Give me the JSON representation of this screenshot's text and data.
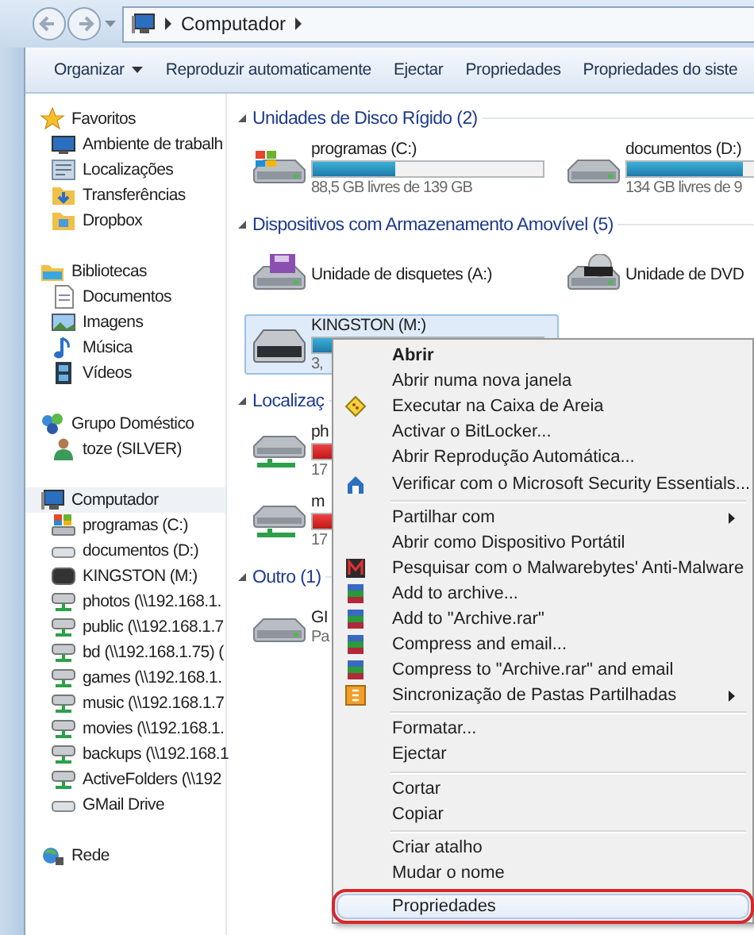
{
  "address_bar": {
    "path": [
      "Computador"
    ]
  },
  "toolbar": [
    {
      "label": "Organizar",
      "dropdown": true
    },
    {
      "label": "Reproduzir automaticamente",
      "dropdown": false
    },
    {
      "label": "Ejectar",
      "dropdown": false
    },
    {
      "label": "Propriedades",
      "dropdown": false
    },
    {
      "label": "Propriedades do siste",
      "dropdown": false
    }
  ],
  "sidebar": [
    {
      "label": "Favoritos",
      "kind": "star",
      "selected": false,
      "items": [
        {
          "label": "Ambiente de trabalh",
          "kind": "desktop"
        },
        {
          "label": "Localizações",
          "kind": "places"
        },
        {
          "label": "Transferências",
          "kind": "downloads"
        },
        {
          "label": "Dropbox",
          "kind": "folder"
        }
      ]
    },
    {
      "label": "Bibliotecas",
      "kind": "library",
      "selected": false,
      "items": [
        {
          "label": "Documentos",
          "kind": "document"
        },
        {
          "label": "Imagens",
          "kind": "picture"
        },
        {
          "label": "Música",
          "kind": "music"
        },
        {
          "label": "Vídeos",
          "kind": "film"
        }
      ]
    },
    {
      "label": "Grupo Doméstico",
      "kind": "homegroup",
      "selected": false,
      "items": [
        {
          "label": "toze (SILVER)",
          "kind": "user"
        }
      ]
    },
    {
      "label": "Computador",
      "kind": "computer",
      "selected": true,
      "items": [
        {
          "label": "programas (C:)",
          "kind": "windrive"
        },
        {
          "label": "documentos (D:)",
          "kind": "drive"
        },
        {
          "label": "KINGSTON (M:)",
          "kind": "usb"
        },
        {
          "label": "photos (\\\\192.168.1.",
          "kind": "netdrive"
        },
        {
          "label": "public (\\\\192.168.1.7",
          "kind": "netdrive"
        },
        {
          "label": "bd (\\\\192.168.1.75) (",
          "kind": "netdrive"
        },
        {
          "label": "games (\\\\192.168.1.",
          "kind": "netdrive"
        },
        {
          "label": "music (\\\\192.168.1.7",
          "kind": "netdrive"
        },
        {
          "label": "movies (\\\\192.168.1.",
          "kind": "netdrive"
        },
        {
          "label": "backups (\\\\192.168.1",
          "kind": "netdrive"
        },
        {
          "label": "ActiveFolders (\\\\192",
          "kind": "netdrive"
        },
        {
          "label": "GMail Drive",
          "kind": "drive"
        }
      ]
    },
    {
      "label": "Rede",
      "kind": "network",
      "selected": false
    }
  ],
  "sections": [
    {
      "title": "Unidades de Disco Rígido (2)",
      "items": [
        {
          "name": "programas (C:)",
          "kind": "windrive",
          "level": 0.36,
          "low_space": false,
          "info": "88,5 GB livres de 139 GB",
          "selected": false
        },
        {
          "name": "documentos (D:)",
          "kind": "drive",
          "level": 0.5,
          "low_space": false,
          "info": "134 GB livres de 9",
          "selected": false
        }
      ]
    },
    {
      "title": "Dispositivos com Armazenamento Amovível (5)",
      "items": [
        {
          "name": "Unidade de disquetes (A:)",
          "kind": "floppy",
          "selected": false
        },
        {
          "name": "Unidade de DVD",
          "kind": "dvd",
          "selected": false
        },
        {
          "name": "KINGSTON (M:)",
          "kind": "usb",
          "level": 0.5,
          "low_space": false,
          "info": "3,",
          "selected": true
        }
      ]
    },
    {
      "title": "Localizaç",
      "items": [
        {
          "name": "ph",
          "kind": "netdrive",
          "level": 0.95,
          "low_space": true,
          "info": "17",
          "selected": false
        },
        {
          "name": "m",
          "kind": "netdrive",
          "level": 0.95,
          "low_space": true,
          "info": "17",
          "selected": false
        }
      ]
    },
    {
      "title": "Outro (1)",
      "items": [
        {
          "name": "GI",
          "kind": "drive",
          "info": "Pa",
          "selected": false
        }
      ]
    }
  ],
  "context_menu": {
    "groups": [
      [
        {
          "label": "Abrir",
          "default": true,
          "kind": "plain",
          "submenu": false,
          "highlighted": false
        },
        {
          "label": "Abrir numa nova janela",
          "default": false,
          "kind": "plain",
          "submenu": false,
          "highlighted": false
        },
        {
          "label": "Executar na Caixa de Areia",
          "default": false,
          "kind": "sandbox",
          "submenu": false,
          "highlighted": false
        },
        {
          "label": "Activar o BitLocker...",
          "default": false,
          "kind": "plain",
          "submenu": false,
          "highlighted": false
        },
        {
          "label": "Abrir Reprodução Automática...",
          "default": false,
          "kind": "plain",
          "submenu": false,
          "highlighted": false
        },
        {
          "label": "Verificar com o Microsoft Security Essentials...",
          "default": false,
          "kind": "house",
          "submenu": false,
          "highlighted": false
        }
      ],
      [
        {
          "label": "Partilhar com",
          "default": false,
          "kind": "plain",
          "submenu": true,
          "highlighted": false
        },
        {
          "label": "Abrir como Dispositivo Portátil",
          "default": false,
          "kind": "plain",
          "submenu": false,
          "highlighted": false
        },
        {
          "label": "Pesquisar com o Malwarebytes' Anti-Malware",
          "default": false,
          "kind": "malware",
          "submenu": false,
          "highlighted": false
        },
        {
          "label": "Add to archive...",
          "default": false,
          "kind": "archive",
          "submenu": false,
          "highlighted": false
        },
        {
          "label": "Add to \"Archive.rar\"",
          "default": false,
          "kind": "archive",
          "submenu": false,
          "highlighted": false
        },
        {
          "label": "Compress and email...",
          "default": false,
          "kind": "archive",
          "submenu": false,
          "highlighted": false
        },
        {
          "label": "Compress to \"Archive.rar\" and email",
          "default": false,
          "kind": "archive",
          "submenu": false,
          "highlighted": false
        },
        {
          "label": "Sincronização de Pastas Partilhadas",
          "default": false,
          "kind": "sync",
          "submenu": true,
          "highlighted": false
        }
      ],
      [
        {
          "label": "Formatar...",
          "default": false,
          "kind": "plain",
          "submenu": false,
          "highlighted": false
        },
        {
          "label": "Ejectar",
          "default": false,
          "kind": "plain",
          "submenu": false,
          "highlighted": false
        }
      ],
      [
        {
          "label": "Cortar",
          "default": false,
          "kind": "plain",
          "submenu": false,
          "highlighted": false
        },
        {
          "label": "Copiar",
          "default": false,
          "kind": "plain",
          "submenu": false,
          "highlighted": false
        }
      ],
      [
        {
          "label": "Criar atalho",
          "default": false,
          "kind": "plain",
          "submenu": false,
          "highlighted": false
        },
        {
          "label": "Mudar o nome",
          "default": false,
          "kind": "plain",
          "submenu": false,
          "highlighted": false
        }
      ],
      [
        {
          "label": "Propriedades",
          "default": false,
          "kind": "plain",
          "submenu": false,
          "highlighted": true,
          "circled": true
        }
      ]
    ]
  }
}
